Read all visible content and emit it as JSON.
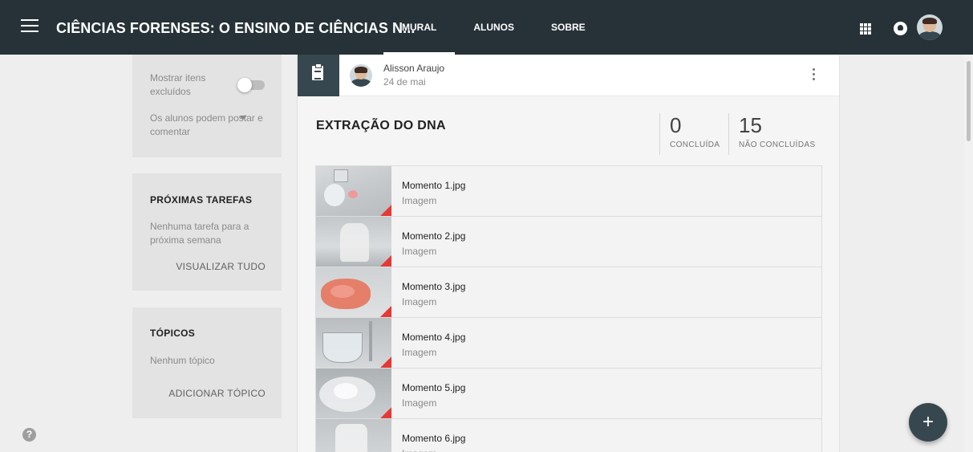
{
  "header": {
    "course_title": "CIÊNCIAS FORENSES: O ENSINO DE CIÊNCIAS N...",
    "tabs": [
      {
        "label": "MURAL",
        "active": true
      },
      {
        "label": "ALUNOS",
        "active": false
      },
      {
        "label": "SOBRE",
        "active": false
      }
    ],
    "icons": [
      "menu-icon",
      "apps-grid-icon",
      "notifications-icon",
      "account-avatar"
    ],
    "bar_color": "#263238"
  },
  "sidebar": {
    "settings": {
      "show_deleted_label": "Mostrar itens excluídos",
      "show_deleted_on": false,
      "post_permission": "Os alunos podem postar e comentar"
    },
    "upcoming": {
      "heading": "PRÓXIMAS TAREFAS",
      "empty_text": "Nenhuma tarefa para a próxima semana",
      "link": "VISUALIZAR TUDO"
    },
    "topics": {
      "heading": "TÓPICOS",
      "empty_text": "Nenhum tópico",
      "link": "ADICIONAR TÓPICO"
    }
  },
  "post": {
    "type_icon": "assignment-icon",
    "author": "Alisson Araujo",
    "date": "24 de mai",
    "title": "EXTRAÇÃO DO DNA",
    "done_count": "0",
    "done_label": "CONCLUÍDA",
    "pending_count": "15",
    "pending_label": "NÃO CONCLUÍDAS",
    "attachments": [
      {
        "name": "Momento 1.jpg",
        "type": "Imagem"
      },
      {
        "name": "Momento 2.jpg",
        "type": "Imagem"
      },
      {
        "name": "Momento 3.jpg",
        "type": "Imagem"
      },
      {
        "name": "Momento 4.jpg",
        "type": "Imagem"
      },
      {
        "name": "Momento 5.jpg",
        "type": "Imagem"
      },
      {
        "name": "Momento 6.jpg",
        "type": "Imagem"
      }
    ]
  },
  "help_icon": "?",
  "fab_label": "+",
  "accent_color": "#37474f"
}
